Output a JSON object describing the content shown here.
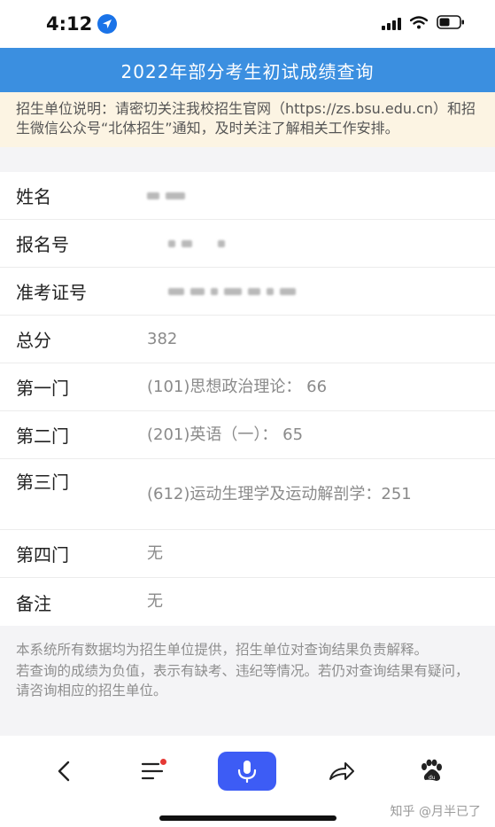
{
  "status_bar": {
    "time": "4:12"
  },
  "header": {
    "title": "2022年部分考生初试成绩查询"
  },
  "notice": {
    "text": "招生单位说明：请密切关注我校招生官网（https://zs.bsu.edu.cn）和招生微信公众号“北体招生”通知，及时关注了解相关工作安排。"
  },
  "results": {
    "name_label": "姓名",
    "reg_label": "报名号",
    "ticket_label": "准考证号",
    "total_label": "总分",
    "total_value": "382",
    "subject1_label": "第一门",
    "subject1_value": "(101)思想政治理论： 66",
    "subject2_label": "第二门",
    "subject2_value": "(201)英语（一）： 65",
    "subject3_label": "第三门",
    "subject3_value": "(612)运动生理学及运动解剖学：251",
    "subject4_label": "第四门",
    "subject4_value": "无",
    "remark_label": "备注",
    "remark_value": "无"
  },
  "footnote": {
    "line1": "本系统所有数据均为招生单位提供，招生单位对查询结果负责解释。",
    "line2": "若查询的成绩为负值，表示有缺考、违纪等情况。若仍对查询结果有疑问，请咨询相应的招生单位。"
  },
  "watermark": "知乎 @月半已了",
  "colors": {
    "title_bar": "#3b8fe0",
    "notice_bg": "#fcf4e3",
    "mic_button": "#3d5cf5"
  }
}
